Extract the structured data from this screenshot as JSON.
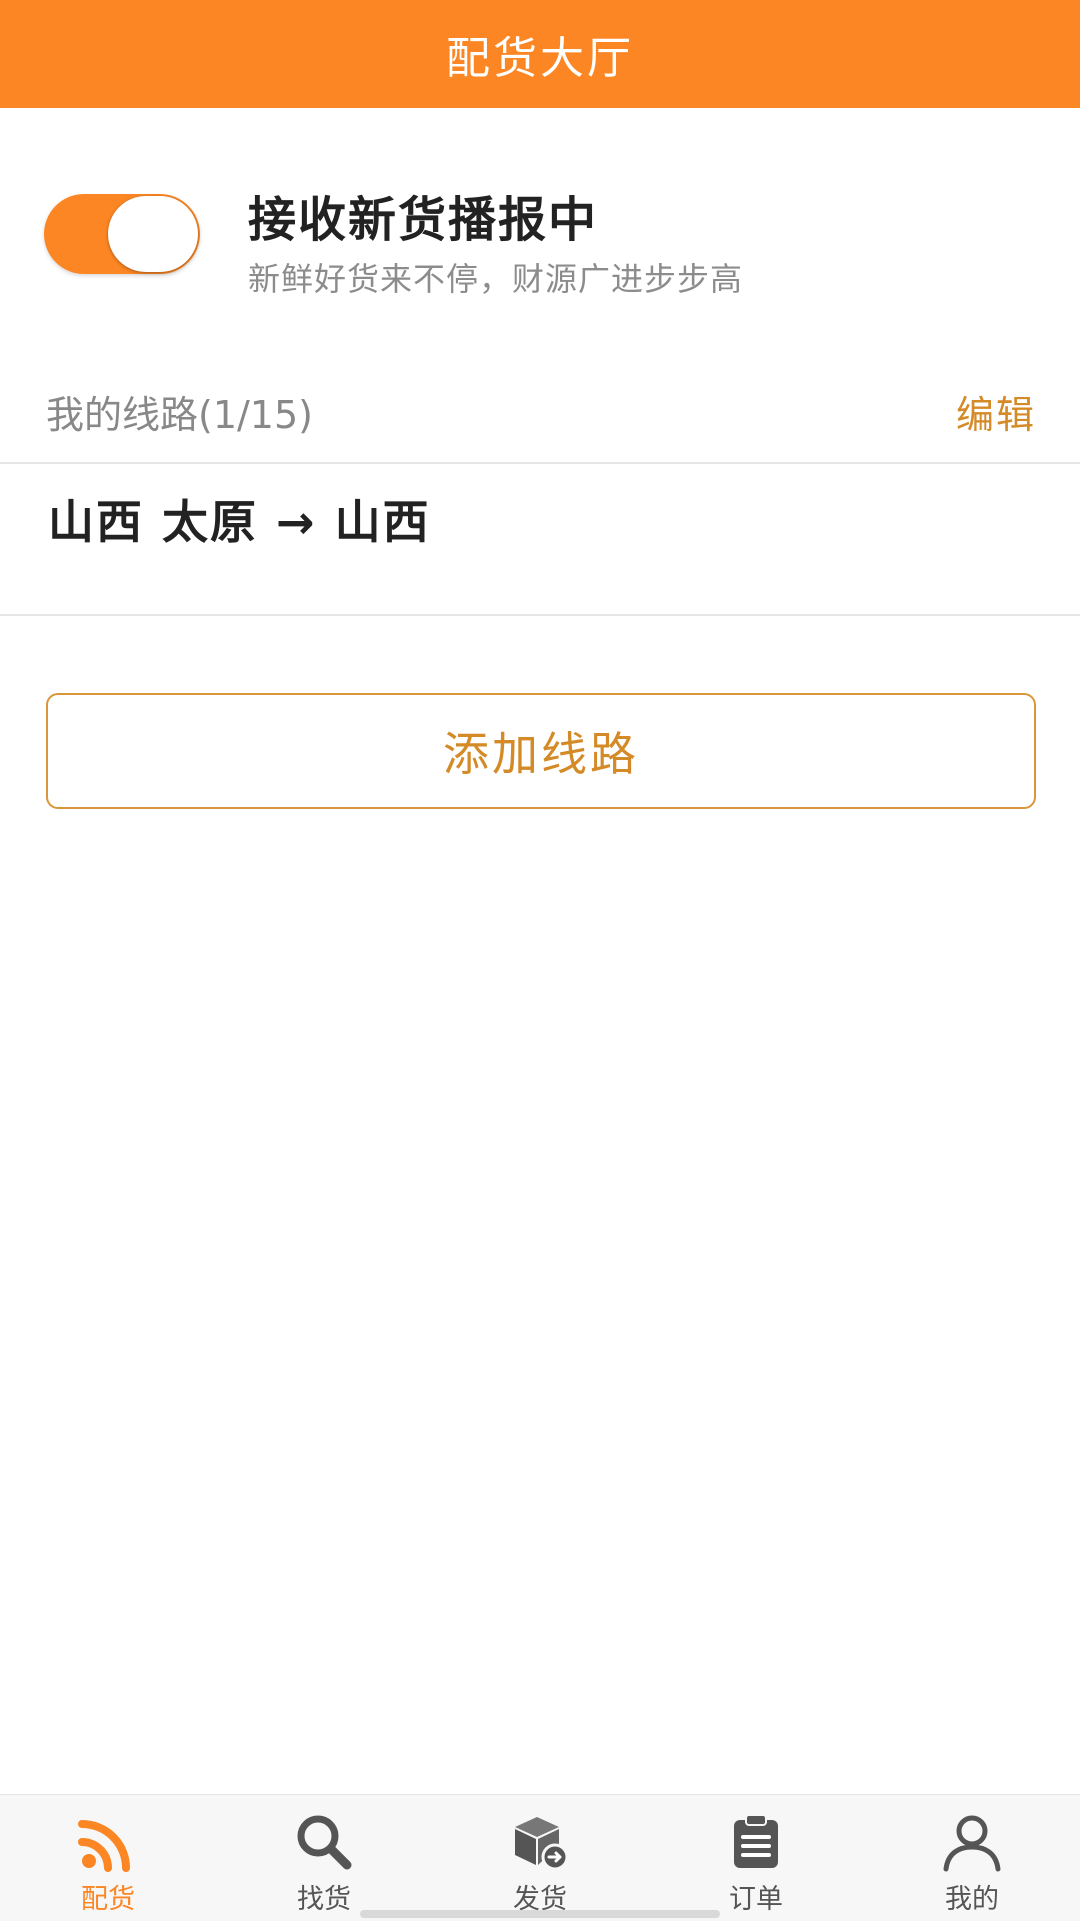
{
  "header": {
    "title": "配货大厅"
  },
  "broadcast": {
    "toggle_on": true,
    "title": "接收新货播报中",
    "subtitle": "新鲜好货来不停，财源广进步步高"
  },
  "routes": {
    "count_label": "我的线路(1/15)",
    "edit_label": "编辑",
    "items": [
      {
        "label": "山西 太原 → 山西"
      }
    ],
    "add_label": "添加线路"
  },
  "tabbar": {
    "tabs": [
      {
        "label": "配货",
        "icon": "rss-icon",
        "active": true
      },
      {
        "label": "找货",
        "icon": "search-icon",
        "active": false
      },
      {
        "label": "发货",
        "icon": "package-send-icon",
        "active": false
      },
      {
        "label": "订单",
        "icon": "clipboard-icon",
        "active": false
      },
      {
        "label": "我的",
        "icon": "user-icon",
        "active": false
      }
    ]
  },
  "colors": {
    "accent": "#fb8623",
    "link": "#d48a26",
    "inactive_icon": "#555555"
  }
}
